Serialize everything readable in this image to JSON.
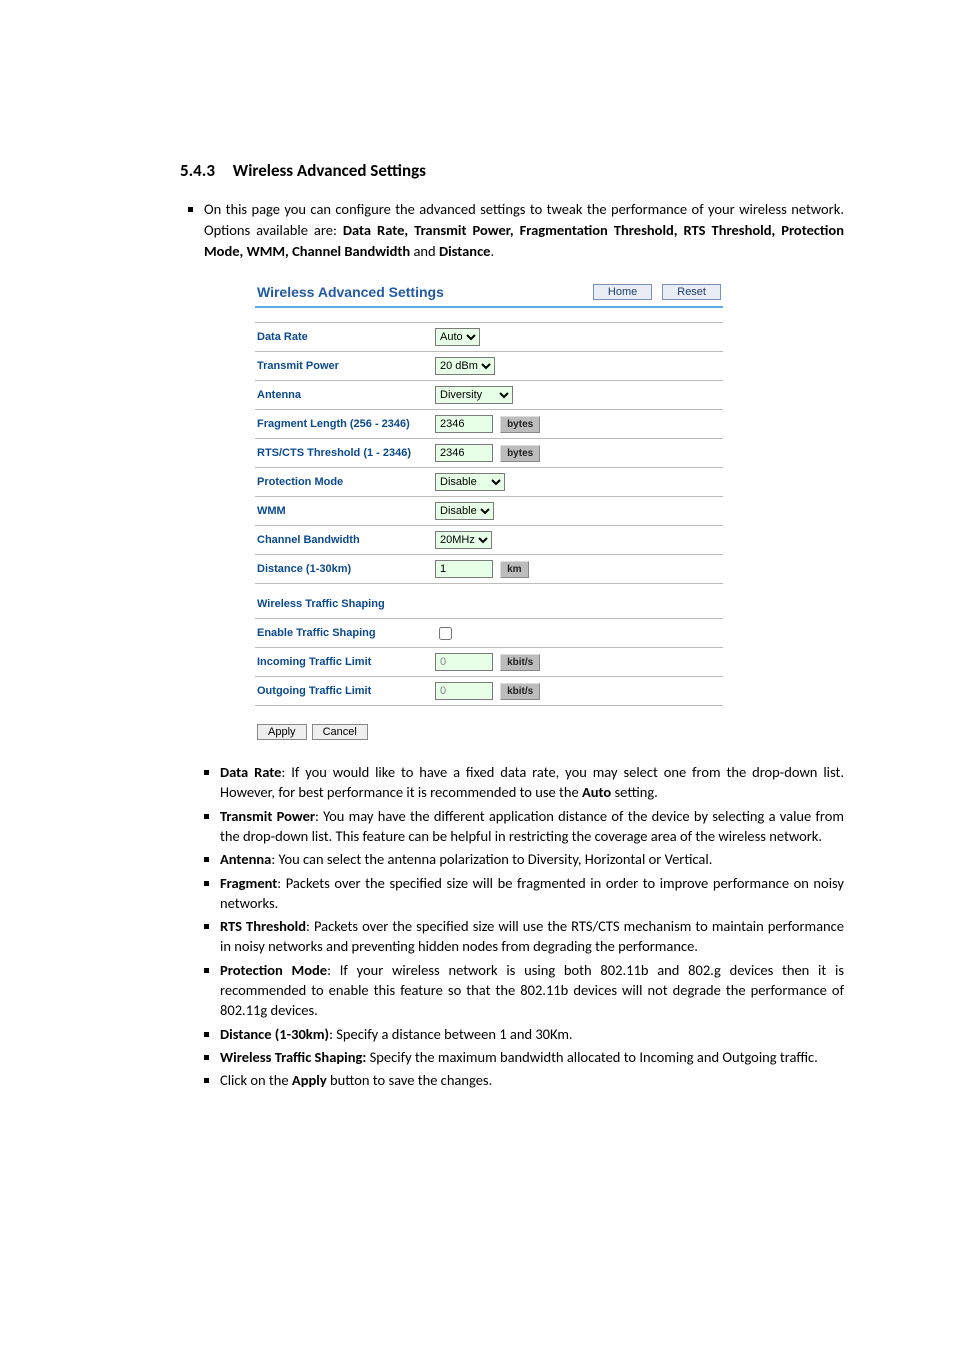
{
  "section": {
    "number": "5.4.3",
    "title": "Wireless Advanced Settings"
  },
  "intro": {
    "pre": "On this page you can configure the advanced settings to tweak the performance of your wireless network. Options available are: ",
    "bold1": "Data Rate, Transmit Power, Fragmentation Threshold, RTS Threshold, Protection Mode, WMM, Channel Bandwidth",
    "mid": " and ",
    "bold2": "Distance",
    "end": "."
  },
  "panel": {
    "title": "Wireless Advanced Settings",
    "home": "Home",
    "reset": "Reset",
    "rows": {
      "data_rate": {
        "label": "Data Rate",
        "value": "Auto"
      },
      "tx_power": {
        "label": "Transmit Power",
        "value": "20 dBm"
      },
      "antenna": {
        "label": "Antenna",
        "value": "Diversity"
      },
      "fragment": {
        "label": "Fragment Length (256 - 2346)",
        "value": "2346",
        "unit": "bytes"
      },
      "rts": {
        "label": "RTS/CTS Threshold (1 - 2346)",
        "value": "2346",
        "unit": "bytes"
      },
      "protection": {
        "label": "Protection Mode",
        "value": "Disable"
      },
      "wmm": {
        "label": "WMM",
        "value": "Disable"
      },
      "chan_bw": {
        "label": "Channel Bandwidth",
        "value": "20MHz"
      },
      "distance": {
        "label": "Distance (1-30km)",
        "value": "1",
        "unit": "km"
      }
    },
    "shaping": {
      "heading": "Wireless Traffic Shaping",
      "enable": {
        "label": "Enable Traffic Shaping"
      },
      "incoming": {
        "label": "Incoming Traffic Limit",
        "value": "0",
        "unit": "kbit/s"
      },
      "outgoing": {
        "label": "Outgoing Traffic Limit",
        "value": "0",
        "unit": "kbit/s"
      }
    },
    "apply": "Apply",
    "cancel": "Cancel"
  },
  "bullets": {
    "data_rate": {
      "h": "Data Rate",
      "t1": ": If you would like to have a fixed data rate, you may select one from the drop-down list. However, for best performance it is recommended to use the ",
      "b1": "Auto",
      "t2": " setting."
    },
    "tx_power": {
      "h": "Transmit Power",
      "t": ": You may have the different application distance of the device by selecting a value from the drop-down list. This feature can be helpful in restricting the coverage area of the wireless network."
    },
    "antenna": {
      "h": "Antenna",
      "t": ": You can select the antenna polarization to Diversity, Horizontal or Vertical."
    },
    "fragment": {
      "h": "Fragment",
      "t": ": Packets over the specified size will be fragmented in order to improve performance on noisy networks."
    },
    "rts": {
      "h": "RTS Threshold",
      "t": ": Packets over the specified size will use the RTS/CTS mechanism to maintain performance in noisy networks and preventing hidden nodes from degrading the performance."
    },
    "protection": {
      "h": "Protection Mode",
      "t": ": If your wireless network is using both 802.11b and 802.g devices then it is recommended to enable this feature so that the 802.11b devices will not degrade the performance of 802.11g devices."
    },
    "distance": {
      "h": "Distance (1-30km)",
      "t": ": Specify a distance between 1 and 30Km."
    },
    "shaping": {
      "h": "Wireless Traffic Shaping:",
      "t": " Specify the maximum bandwidth allocated to Incoming and Outgoing traffic."
    },
    "apply": {
      "t1": "Click on the ",
      "b": "Apply",
      "t2": " button to save the changes."
    }
  }
}
